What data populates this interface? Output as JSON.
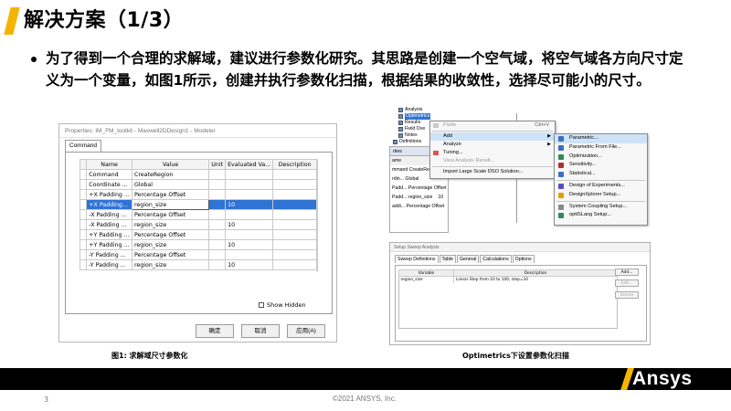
{
  "slide": {
    "title": "解决方案（1/3）",
    "bullet": "为了得到一个合理的求解域，建议进行参数化研究。其思路是创建一个空气域，将空气域各方向尺寸定义为一个变量，如图1所示，创建并执行参数化扫描，根据结果的收敛性，选择尽可能小的尺寸。",
    "page_number": "3",
    "copyright": "©2021 ANSYS, Inc.",
    "logo": "Ansys",
    "accent_color": "#f5b400"
  },
  "properties_dialog": {
    "title": "Properties: IM_FM_toolkit - Maxwell2DDesign1 - Modeler",
    "tab": "Command",
    "columns": [
      "Name",
      "Value",
      "Unit",
      "Evaluated Va...",
      "Description"
    ],
    "rows": [
      {
        "name": "Command",
        "value": "CreateRegion",
        "unit": "",
        "eval": "",
        "desc": ""
      },
      {
        "name": "Coordinate ...",
        "value": "Global",
        "unit": "",
        "eval": "",
        "desc": ""
      },
      {
        "name": "+X Padding ...",
        "value": "Percentage Offset",
        "unit": "",
        "eval": "",
        "desc": ""
      },
      {
        "name": "+X Padding...",
        "value": "region_size",
        "unit": "",
        "eval": "10",
        "desc": ""
      },
      {
        "name": "-X Padding ...",
        "value": "Percentage Offset",
        "unit": "",
        "eval": "",
        "desc": ""
      },
      {
        "name": "-X Padding ...",
        "value": "region_size",
        "unit": "",
        "eval": "10",
        "desc": ""
      },
      {
        "name": "+Y Padding ...",
        "value": "Percentage Offset",
        "unit": "",
        "eval": "",
        "desc": ""
      },
      {
        "name": "+Y Padding ...",
        "value": "region_size",
        "unit": "",
        "eval": "10",
        "desc": ""
      },
      {
        "name": "-Y Padding ...",
        "value": "Percentage Offset",
        "unit": "",
        "eval": "",
        "desc": ""
      },
      {
        "name": "-Y Padding ...",
        "value": "region_size",
        "unit": "",
        "eval": "10",
        "desc": ""
      }
    ],
    "selected_row": 3,
    "show_hidden_label": "Show Hidden",
    "buttons": {
      "ok": "确定",
      "cancel": "取消",
      "apply": "应用(A)"
    },
    "caption": "图1: 求解域尺寸参数化"
  },
  "project_tree": {
    "items": [
      "Analysis",
      "Optimetrics",
      "Results",
      "Field Ove",
      "Notes",
      "Definitions"
    ],
    "highlighted": 1
  },
  "background_panel": {
    "header": "rties",
    "col_header": "ame",
    "rows": [
      "mmand CreateRegion",
      "rdin... Global",
      "Padd... Percentage Offset",
      "Padd... region_size",
      "addi... Percentage Offset"
    ],
    "row_values": [
      "",
      "",
      "",
      "10",
      ""
    ]
  },
  "context_menu": {
    "items": [
      {
        "label": "Paste",
        "shortcut": "Ctrl+V",
        "disabled": true
      },
      {
        "label": "Add",
        "submenu": true,
        "highlight": true
      },
      {
        "label": "Analyze",
        "submenu": true
      },
      {
        "label": "Tuning..."
      },
      {
        "label": "View Analysis Result...",
        "disabled": true
      },
      {
        "label": "Import Large Scale DSO Solution..."
      }
    ]
  },
  "add_submenu": {
    "items": [
      {
        "label": "Parametric...",
        "highlight": true,
        "color": "#3a6fc4"
      },
      {
        "label": "Parametric From File...",
        "color": "#3a6fc4"
      },
      {
        "label": "Optimization...",
        "color": "#2e8b57"
      },
      {
        "label": "Sensitivity...",
        "color": "#b03030"
      },
      {
        "label": "Statistical...",
        "color": "#3a6fc4"
      },
      {
        "label": "Design of Experiments...",
        "color": "#5a4fbf"
      },
      {
        "label": "DesignXplorer Setup...",
        "color": "#e0a000"
      },
      {
        "label": "System Coupling Setup...",
        "color": "#888888"
      },
      {
        "label": "optiSLang Setup...",
        "color": "#2e8b57"
      }
    ]
  },
  "sweep_dialog": {
    "title": "Setup Sweep Analysis",
    "tabs": [
      "Sweep Definitions",
      "Table",
      "General",
      "Calculations",
      "Options"
    ],
    "columns": [
      "Variable",
      "Description"
    ],
    "rows": [
      {
        "variable": "region_size",
        "description": "Linear Step from 10 to 100, step=10"
      }
    ],
    "buttons": {
      "add": "Add...",
      "edit": "Edit...",
      "delete": "Delete"
    },
    "caption": "Optimetrics下设置参数化扫描"
  }
}
